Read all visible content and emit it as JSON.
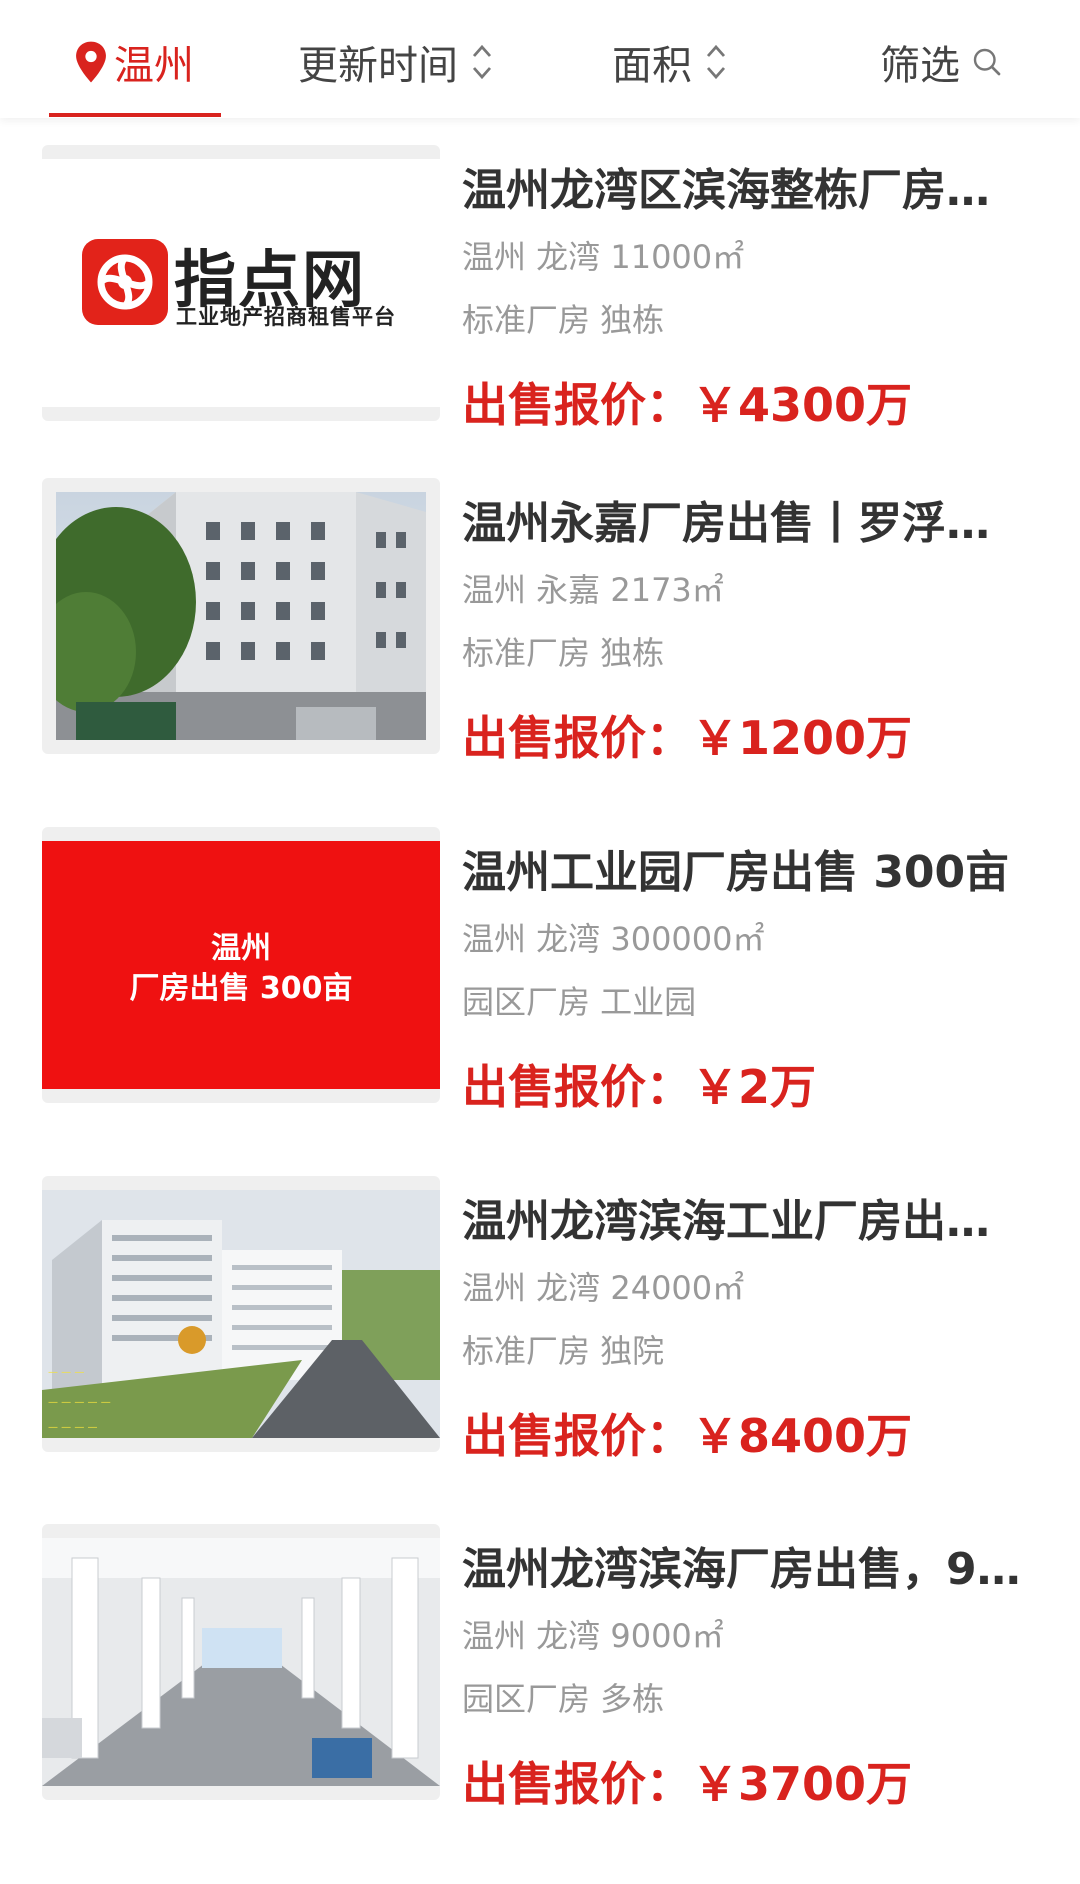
{
  "filter_bar": {
    "city": "温州",
    "sort_time": "更新时间",
    "sort_area": "面积",
    "filter": "筛选"
  },
  "logo": {
    "name": "指点网",
    "tagline": "工业地产招商租售平台"
  },
  "promo_card": {
    "line1": "温州",
    "line2": "厂房出售 300亩"
  },
  "listings": [
    {
      "title": "温州龙湾区滨海整栋厂房…",
      "meta": "温州 龙湾 11000㎡",
      "tags": "标准厂房 独栋",
      "price": "出售报价：￥4300万",
      "thumb": "logo"
    },
    {
      "title": "温州永嘉厂房出售丨罗浮…",
      "meta": "温州 永嘉 2173㎡",
      "tags": "标准厂房 独栋",
      "price": "出售报价：￥1200万",
      "thumb": "photo-building"
    },
    {
      "title": "温州工业园厂房出售 300亩",
      "meta": "温州 龙湾 300000㎡",
      "tags": "园区厂房 工业园",
      "price": "出售报价：￥2万",
      "thumb": "red-card"
    },
    {
      "title": "温州龙湾滨海工业厂房出…",
      "meta": "温州 龙湾 24000㎡",
      "tags": "标准厂房 独院",
      "price": "出售报价：￥8400万",
      "thumb": "photo-park"
    },
    {
      "title": "温州龙湾滨海厂房出售，9…",
      "meta": "温州 龙湾 9000㎡",
      "tags": "园区厂房 多栋",
      "price": "出售报价：￥3700万",
      "thumb": "photo-interior"
    }
  ],
  "colors": {
    "accent": "#d9231e",
    "title": "#333333",
    "muted": "#999999"
  }
}
